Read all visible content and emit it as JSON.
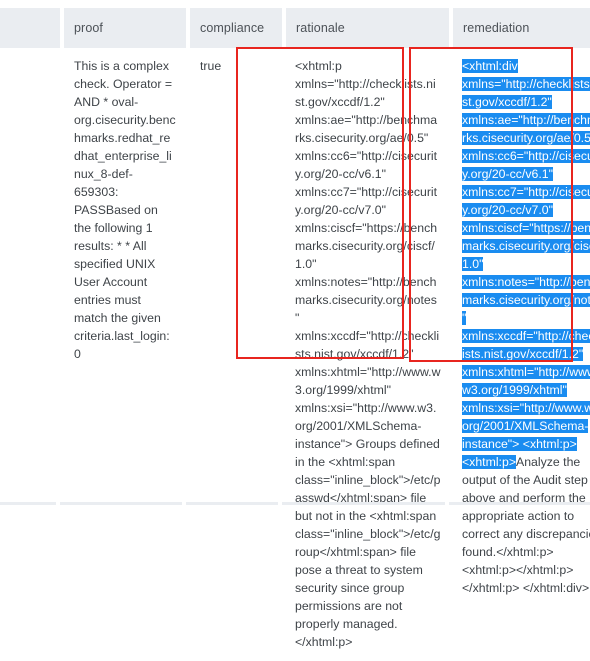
{
  "table": {
    "columns": [
      {
        "key": "gutter",
        "label": ""
      },
      {
        "key": "proof",
        "label": "proof"
      },
      {
        "key": "compliance",
        "label": "compliance"
      },
      {
        "key": "rationale",
        "label": "rationale"
      },
      {
        "key": "remediation",
        "label": "remediation"
      }
    ],
    "row": {
      "proof": "This is a complex check. Operator = AND * oval-org.cisecurity.benchmarks.redhat_redhat_enterprise_linux_8-def-659303: PASSBased on the following 1 results: * * All specified UNIX User Account entries must match the given criteria.last_login: 0",
      "compliance": "true",
      "rationale_boxed": "<xhtml:p xmlns=\"http://checklists.nist.gov/xccdf/1.2\" xmlns:ae=\"http://benchmarks.cisecurity.org/ae/0.5\" xmlns:cc6=\"http://cisecurity.org/20-cc/v6.1\" xmlns:cc7=\"http://cisecurity.org/20-cc/v7.0\" xmlns:ciscf=\"https://benchmarks.cisecurity.org/ciscf/1.0\" xmlns:notes=\"http://benchmarks.cisecurity.org/notes\" xmlns:xccdf=\"http://checklists.nist.gov/xccdf/1.2\" xmlns:xhtml=\"http://www.w3.org/1999/xhtml\" xmlns:xsi=\"http://www.w3.org/2001/XMLSchema-instance\">",
      "rationale_rest": "Groups defined in the <xhtml:span class=\"inline_block\">/etc/passwd</xhtml:span> file but not in the <xhtml:span class=\"inline_block\">/etc/group</xhtml:span> file pose a threat to system security since group permissions are not properly managed. </xhtml:p>",
      "remediation_selected": "<xhtml:div xmlns=\"http://checklists.nist.gov/xccdf/1.2\" xmlns:ae=\"http://benchmarks.cisecurity.org/ae/0.5\" xmlns:cc6=\"http://cisecurity.org/20-cc/v6.1\" xmlns:cc7=\"http://cisecurity.org/20-cc/v7.0\" xmlns:ciscf=\"https://benchmarks.cisecurity.org/ciscf/1.0\" xmlns:notes=\"http://benchmarks.cisecurity.org/notes\" xmlns:xccdf=\"http://checklists.nist.gov/xccdf/1.2\" xmlns:xhtml=\"http://www.w3.org/1999/xhtml\" xmlns:xsi=\"http://www.w3.org/2001/XMLSchema-instance\"> <xhtml:p> <xhtml:p>",
      "remediation_rest": "Analyze the output of the Audit step above and perform the appropriate action to correct any discrepancies found.</xhtml:p> <xhtml:p></xhtml:p> </xhtml:p> </xhtml:div>"
    }
  },
  "annotations": {
    "box_color": "#e8251f",
    "selection_color": "#1a8cf0",
    "boxes": [
      {
        "name": "rationale-highlight-box",
        "target": "rationale"
      },
      {
        "name": "remediation-highlight-box",
        "target": "remediation"
      }
    ]
  }
}
